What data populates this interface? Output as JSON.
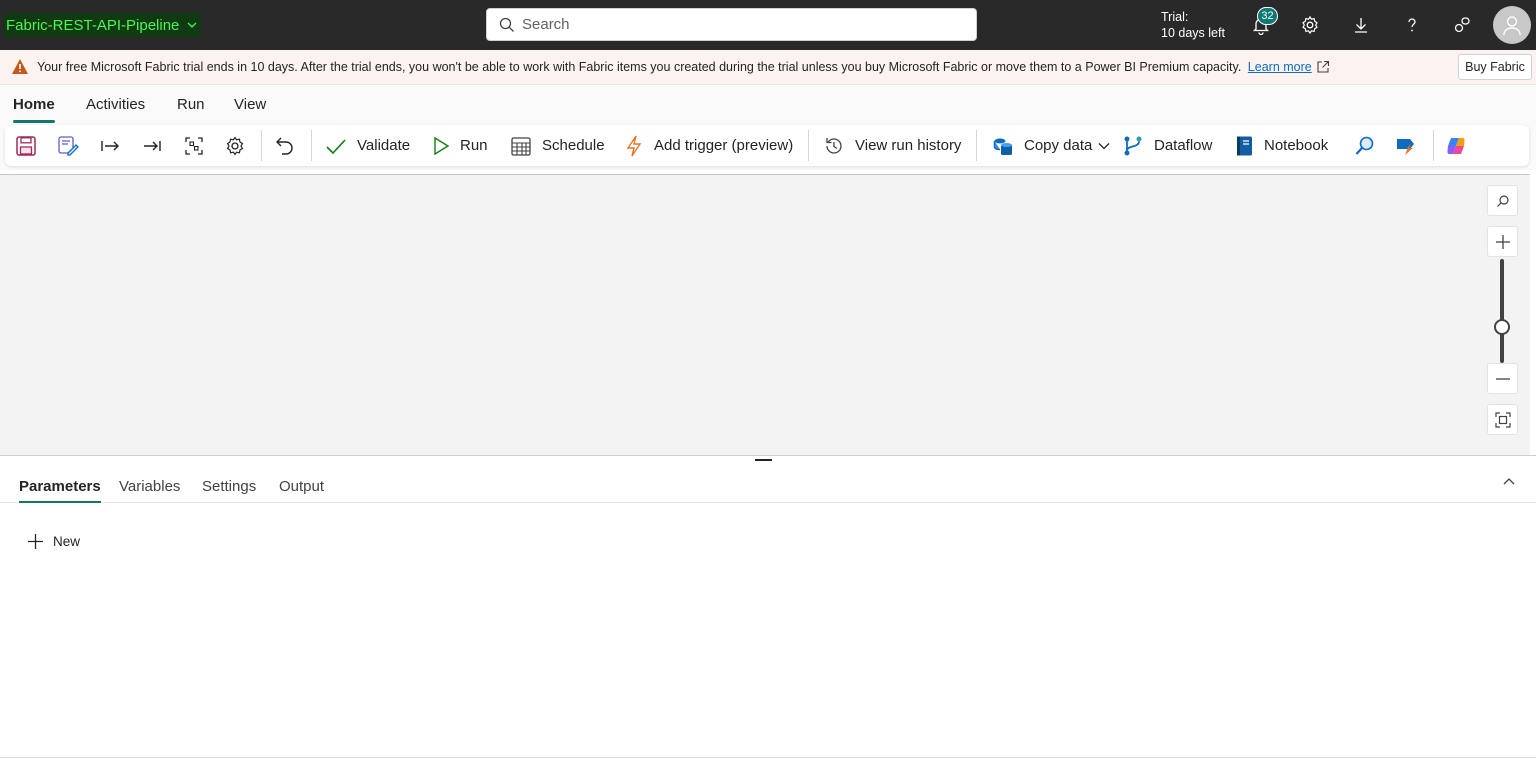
{
  "app": {
    "title": "Fabric-REST-API-Pipeline"
  },
  "search": {
    "placeholder": "Search"
  },
  "header": {
    "trial_line1": "Trial:",
    "trial_line2": "10 days left",
    "notification_count": "32"
  },
  "banner": {
    "text": "Your free Microsoft Fabric trial ends in 10 days. After the trial ends, you won't be able to work with Fabric items you created during the trial unless you buy Microsoft Fabric or move them to a Power BI Premium capacity.",
    "link": "Learn more",
    "buy_button": "Buy Fabric"
  },
  "menu_tabs": [
    "Home",
    "Activities",
    "Run",
    "View"
  ],
  "toolbar": {
    "validate": "Validate",
    "run": "Run",
    "schedule": "Schedule",
    "add_trigger": "Add trigger (preview)",
    "view_run_history": "View run history",
    "copy_data": "Copy data",
    "dataflow": "Dataflow",
    "notebook": "Notebook"
  },
  "bottom_panel": {
    "tabs": [
      "Parameters",
      "Variables",
      "Settings",
      "Output"
    ],
    "new_button": "New"
  },
  "colors": {
    "topbar": "#292929",
    "accent": "#117865",
    "title_highlight": "#0f3a12",
    "title_text": "#4cf552",
    "warning": "#c25a1e",
    "badge": "#0e7a74"
  }
}
